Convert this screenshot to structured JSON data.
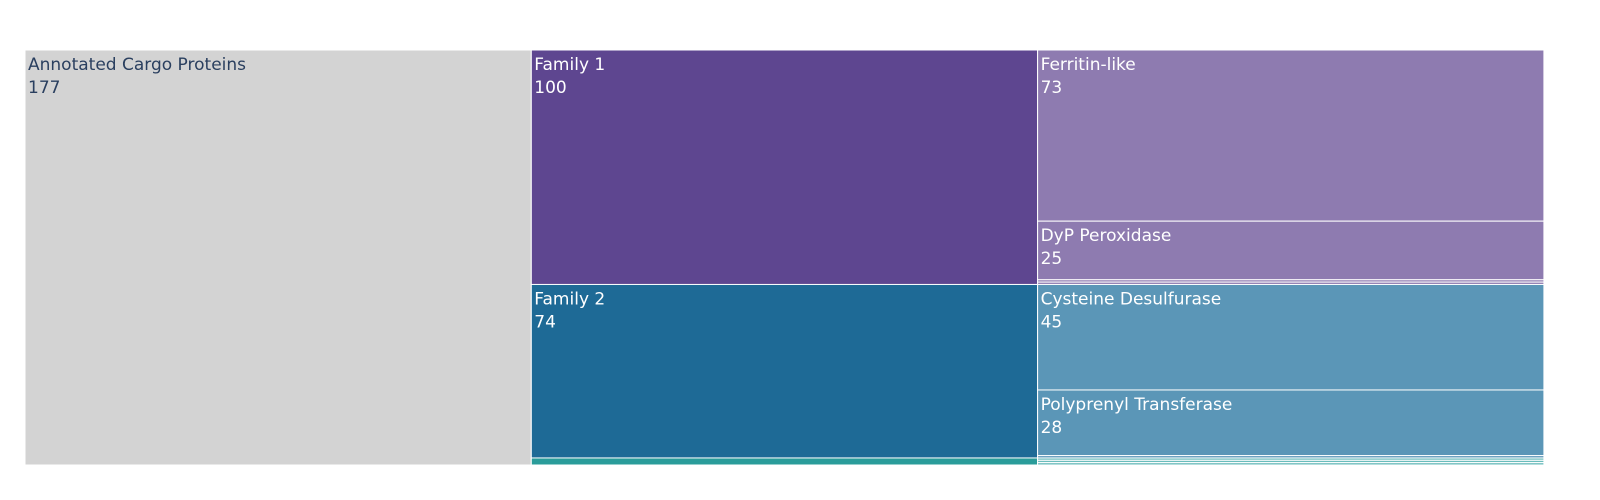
{
  "chart_data": {
    "type": "icicle",
    "root": {
      "label": "Annotated Cargo Proteins",
      "value": 177,
      "color": "#d3d3d3",
      "text_color": "#2a3f5f",
      "children": [
        {
          "label": "Family 1",
          "value": 100,
          "color": "#5e4690",
          "child_color": "#8e7bb0",
          "children": [
            {
              "label": "Ferritin-like",
              "value": 73
            },
            {
              "label": "DyP Peroxidase",
              "value": 25
            },
            {
              "label": "",
              "value": 1
            },
            {
              "label": "",
              "value": 1
            }
          ]
        },
        {
          "label": "Family 2",
          "value": 74,
          "color": "#1e6a96",
          "child_color": "#5b96b7",
          "children": [
            {
              "label": "Cysteine Desulfurase",
              "value": 45
            },
            {
              "label": "Polyprenyl Transferase",
              "value": 28
            },
            {
              "label": "",
              "value": 1
            }
          ]
        },
        {
          "label": "",
          "value": 3,
          "color": "#2a9c9a",
          "child_color": "#6bbcbc",
          "children": [
            {
              "label": "",
              "value": 1
            },
            {
              "label": "",
              "value": 1
            },
            {
              "label": "",
              "value": 1
            }
          ]
        }
      ]
    }
  }
}
